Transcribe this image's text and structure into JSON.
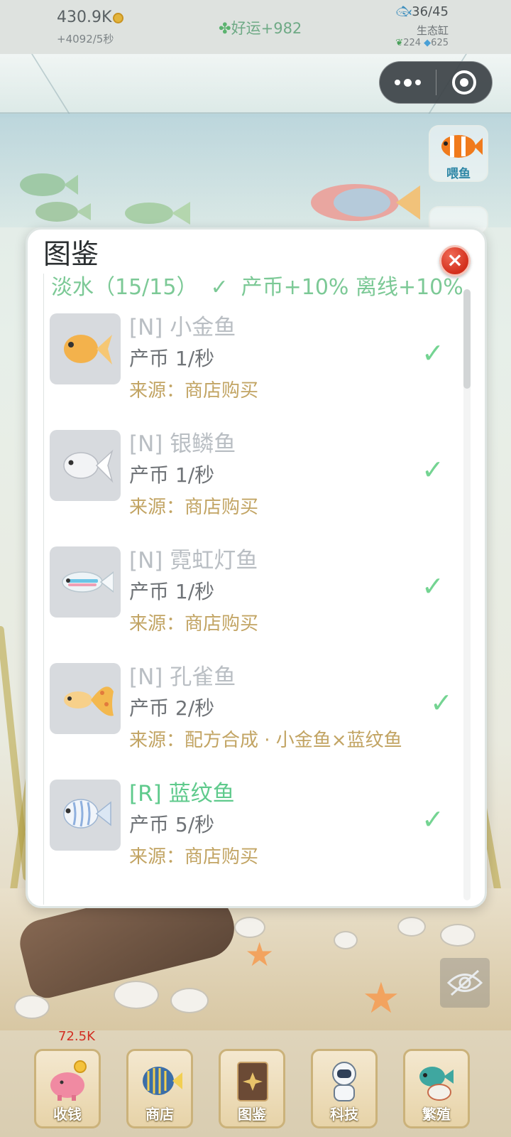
{
  "status_bar": {
    "coins": "430.9K",
    "coin_rate": "+4092/5秒",
    "luck_icon": "clover-icon",
    "luck": "好运+982",
    "fish_count": "36/45",
    "eco_label": "生态缸",
    "leaf_count": "224",
    "gem_count": "625"
  },
  "side_buttons": {
    "feed_label": "喂鱼"
  },
  "modal": {
    "title": "图鉴",
    "section_header": {
      "name": "淡水（15/15）",
      "check": "✓",
      "bonus": "产币+10% 离线+10%"
    },
    "items": [
      {
        "name": "[N] 小金鱼",
        "rate": "产币 1/秒",
        "source": "来源：商店购买",
        "rarity": "N",
        "color": "#f2b04a"
      },
      {
        "name": "[N] 银鳞鱼",
        "rate": "产币 1/秒",
        "source": "来源：商店购买",
        "rarity": "N",
        "color": "#eef0f2"
      },
      {
        "name": "[N] 霓虹灯鱼",
        "rate": "产币 1/秒",
        "source": "来源：商店购买",
        "rarity": "N",
        "color": "#bfe6f2"
      },
      {
        "name": "[N] 孔雀鱼",
        "rate": "产币 2/秒",
        "source": "来源：配方合成 · 小金鱼×蓝纹鱼",
        "rarity": "N",
        "color": "#f3c070"
      },
      {
        "name": "[R] 蓝纹鱼",
        "rate": "产币 5/秒",
        "source": "来源：商店购买",
        "rarity": "R",
        "color": "#cfe1f4"
      }
    ]
  },
  "bottom_nav": {
    "collect_amount": "72.5K",
    "items": [
      {
        "label": "收钱",
        "icon": "piggy-bank-icon"
      },
      {
        "label": "商店",
        "icon": "angelfish-icon"
      },
      {
        "label": "图鉴",
        "icon": "book-icon"
      },
      {
        "label": "科技",
        "icon": "astronaut-icon"
      },
      {
        "label": "繁殖",
        "icon": "breeding-fish-icon"
      }
    ]
  },
  "colors": {
    "rare_green": "#5fca8c",
    "source_gold": "#c2a463",
    "check_green": "#74d492",
    "close_red": "#d32f1c"
  }
}
